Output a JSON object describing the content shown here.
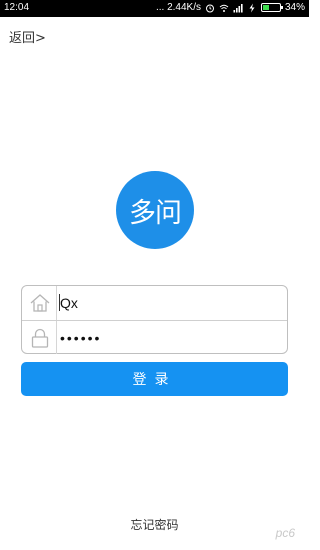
{
  "status_bar": {
    "time": "12:04",
    "network_speed": "... 2.44K/s",
    "battery_percent": "34%",
    "battery_level": 0.34
  },
  "nav": {
    "back_label": "返回>"
  },
  "logo": {
    "text": "多问",
    "color": "#1e8fe8"
  },
  "form": {
    "username": {
      "value": "Qx",
      "icon": "home-icon"
    },
    "password": {
      "value": "qwerty",
      "icon": "lock-icon"
    }
  },
  "login_button": {
    "label": "登录",
    "color": "#1592f2"
  },
  "forgot_password": {
    "label": "忘记密码"
  },
  "watermark": {
    "text": "pc6"
  }
}
